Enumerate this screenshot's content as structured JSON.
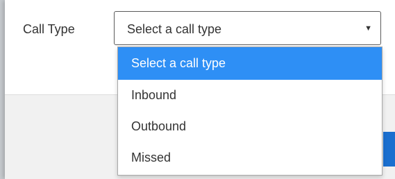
{
  "form": {
    "call_type_label": "Call Type",
    "select": {
      "selected_value": "Select a call type",
      "arrow_icon": "caret-down-icon",
      "options": [
        {
          "label": "Select a call type",
          "highlighted": true
        },
        {
          "label": "Inbound",
          "highlighted": false
        },
        {
          "label": "Outbound",
          "highlighted": false
        },
        {
          "label": "Missed",
          "highlighted": false
        }
      ]
    }
  },
  "colors": {
    "highlight": "#2e8ff5",
    "button_edge": "#1a6fcf",
    "text": "#333333"
  }
}
